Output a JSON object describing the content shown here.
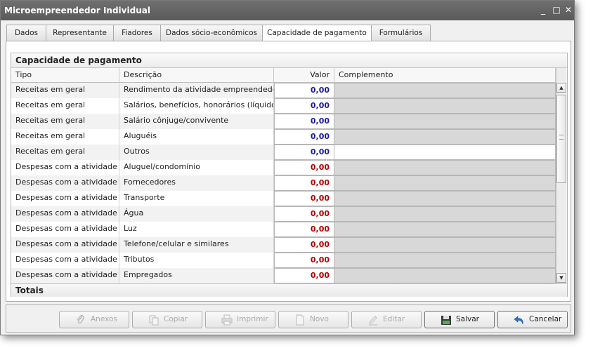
{
  "window": {
    "title": "Microempreendedor Individual",
    "controls": {
      "minimize": "_",
      "maximize": "□",
      "close": "✕"
    }
  },
  "tabs": [
    {
      "label": "Dados"
    },
    {
      "label": "Representante"
    },
    {
      "label": "Fiadores"
    },
    {
      "label": "Dados sócio-econômicos"
    },
    {
      "label": "Capacidade de pagamento",
      "active": true
    },
    {
      "label": "Formulários"
    }
  ],
  "grid": {
    "title": "Capacidade de pagamento",
    "columns": {
      "tipo": "Tipo",
      "descricao": "Descrição",
      "valor": "Valor",
      "complemento": "Complemento"
    },
    "rows": [
      {
        "tipo": "Receitas em geral",
        "descricao": "Rendimento da atividade empreendedora",
        "valor": "0,00",
        "complemento": ""
      },
      {
        "tipo": "Receitas em geral",
        "descricao": "Salários, benefícios, honorários (líquido)",
        "valor": "0,00",
        "complemento": ""
      },
      {
        "tipo": "Receitas em geral",
        "descricao": "Salário cônjuge/convivente",
        "valor": "0,00",
        "complemento": ""
      },
      {
        "tipo": "Receitas em geral",
        "descricao": "Aluguéis",
        "valor": "0,00",
        "complemento": ""
      },
      {
        "tipo": "Receitas em geral",
        "descricao": "Outros",
        "valor": "0,00",
        "complemento": ""
      },
      {
        "tipo": "Despesas com a atividade",
        "descricao": "Aluguel/condomínio",
        "valor": "0,00",
        "complemento": ""
      },
      {
        "tipo": "Despesas com a atividade",
        "descricao": "Fornecedores",
        "valor": "0,00",
        "complemento": ""
      },
      {
        "tipo": "Despesas com a atividade",
        "descricao": "Transporte",
        "valor": "0,00",
        "complemento": ""
      },
      {
        "tipo": "Despesas com a atividade",
        "descricao": "Água",
        "valor": "0,00",
        "complemento": ""
      },
      {
        "tipo": "Despesas com a atividade",
        "descricao": "Luz",
        "valor": "0,00",
        "complemento": ""
      },
      {
        "tipo": "Despesas com a atividade",
        "descricao": "Telefone/celular e similares",
        "valor": "0,00",
        "complemento": ""
      },
      {
        "tipo": "Despesas com a atividade",
        "descricao": "Tributos",
        "valor": "0,00",
        "complemento": ""
      },
      {
        "tipo": "Despesas com a atividade",
        "descricao": "Empregados",
        "valor": "0,00",
        "complemento": ""
      }
    ],
    "totals_label": "Totais"
  },
  "buttons": {
    "anexos": "Anexos",
    "copiar": "Copiar",
    "imprimir": "Imprimir",
    "novo": "Novo",
    "editar": "Editar",
    "salvar": "Salvar",
    "cancelar": "Cancelar"
  },
  "colors": {
    "receita_value": "#1a1aa0",
    "despesa_value": "#b00000",
    "title_bar": "#5f5f5f"
  }
}
